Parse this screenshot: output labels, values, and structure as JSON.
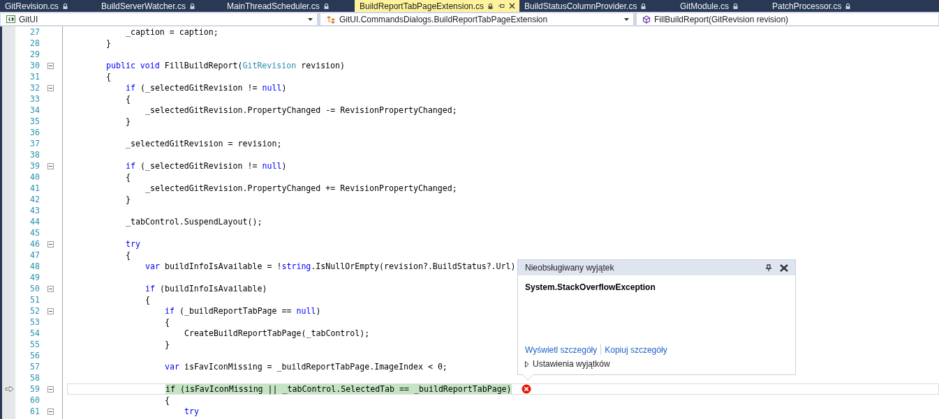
{
  "tabs": [
    {
      "label": "GitRevision.cs",
      "selected": false,
      "locked": true
    },
    {
      "label": "BuildServerWatcher.cs",
      "selected": false,
      "locked": true
    },
    {
      "label": "MainThreadScheduler.cs",
      "selected": false,
      "locked": true
    },
    {
      "label": "BuildReportTabPageExtension.cs",
      "selected": true,
      "locked": true
    },
    {
      "label": "BuildStatusColumnProvider.cs",
      "selected": false,
      "locked": true
    },
    {
      "label": "GitModule.cs",
      "selected": false,
      "locked": true
    },
    {
      "label": "PatchProcessor.cs",
      "selected": false,
      "locked": true
    }
  ],
  "navigation": {
    "project": "GitUI",
    "type": "GitUI.CommandsDialogs.BuildReportTabPageExtension",
    "member": "FillBuildReport(GitRevision revision)"
  },
  "code_lines": [
    {
      "number": "27",
      "collapsible": false,
      "current": false,
      "error": false,
      "segments": [
        {
          "kind": "plain",
          "text": "            _caption = caption;"
        }
      ]
    },
    {
      "number": "28",
      "collapsible": false,
      "current": false,
      "error": false,
      "segments": [
        {
          "kind": "plain",
          "text": "        }"
        }
      ]
    },
    {
      "number": "29",
      "collapsible": false,
      "current": false,
      "error": false
    },
    {
      "number": "30",
      "collapsible": true,
      "current": false,
      "error": false,
      "segments": [
        {
          "kind": "keyword",
          "text": "        public void "
        },
        {
          "kind": "plain",
          "text": "FillBuildReport("
        },
        {
          "kind": "type",
          "text": "GitRevision"
        },
        {
          "kind": "plain",
          "text": " revision)"
        }
      ]
    },
    {
      "number": "31",
      "collapsible": false,
      "current": false,
      "error": false,
      "segments": [
        {
          "kind": "plain",
          "text": "        {"
        }
      ]
    },
    {
      "number": "32",
      "collapsible": true,
      "current": false,
      "error": false,
      "segments": [
        {
          "kind": "keyword",
          "text": "            if"
        },
        {
          "kind": "plain",
          "text": " (_selectedGitRevision != "
        },
        {
          "kind": "keyword",
          "text": "null"
        },
        {
          "kind": "plain",
          "text": ")"
        }
      ]
    },
    {
      "number": "33",
      "collapsible": false,
      "current": false,
      "error": false,
      "segments": [
        {
          "kind": "plain",
          "text": "            {"
        }
      ]
    },
    {
      "number": "34",
      "collapsible": false,
      "current": false,
      "error": false,
      "segments": [
        {
          "kind": "plain",
          "text": "                _selectedGitRevision.PropertyChanged -= RevisionPropertyChanged;"
        }
      ]
    },
    {
      "number": "35",
      "collapsible": false,
      "current": false,
      "error": false,
      "segments": [
        {
          "kind": "plain",
          "text": "            }"
        }
      ]
    },
    {
      "number": "36",
      "collapsible": false,
      "current": false,
      "error": false
    },
    {
      "number": "37",
      "collapsible": false,
      "current": false,
      "error": false,
      "segments": [
        {
          "kind": "plain",
          "text": "            _selectedGitRevision = revision;"
        }
      ]
    },
    {
      "number": "38",
      "collapsible": false,
      "current": false,
      "error": false
    },
    {
      "number": "39",
      "collapsible": true,
      "current": false,
      "error": false,
      "segments": [
        {
          "kind": "keyword",
          "text": "            if"
        },
        {
          "kind": "plain",
          "text": " (_selectedGitRevision != "
        },
        {
          "kind": "keyword",
          "text": "null"
        },
        {
          "kind": "plain",
          "text": ")"
        }
      ]
    },
    {
      "number": "40",
      "collapsible": false,
      "current": false,
      "error": false,
      "segments": [
        {
          "kind": "plain",
          "text": "            {"
        }
      ]
    },
    {
      "number": "41",
      "collapsible": false,
      "current": false,
      "error": false,
      "segments": [
        {
          "kind": "plain",
          "text": "                _selectedGitRevision.PropertyChanged += RevisionPropertyChanged;"
        }
      ]
    },
    {
      "number": "42",
      "collapsible": false,
      "current": false,
      "error": false,
      "segments": [
        {
          "kind": "plain",
          "text": "            }"
        }
      ]
    },
    {
      "number": "43",
      "collapsible": false,
      "current": false,
      "error": false
    },
    {
      "number": "44",
      "collapsible": false,
      "current": false,
      "error": false,
      "segments": [
        {
          "kind": "plain",
          "text": "            _tabControl.SuspendLayout();"
        }
      ]
    },
    {
      "number": "45",
      "collapsible": false,
      "current": false,
      "error": false
    },
    {
      "number": "46",
      "collapsible": true,
      "current": false,
      "error": false,
      "segments": [
        {
          "kind": "keyword",
          "text": "            try"
        }
      ]
    },
    {
      "number": "47",
      "collapsible": false,
      "current": false,
      "error": false,
      "segments": [
        {
          "kind": "plain",
          "text": "            {"
        }
      ]
    },
    {
      "number": "48",
      "collapsible": false,
      "current": false,
      "error": false,
      "segments": [
        {
          "kind": "keyword",
          "text": "                var"
        },
        {
          "kind": "plain",
          "text": " buildInfoIsAvailable = !"
        },
        {
          "kind": "keyword",
          "text": "string"
        },
        {
          "kind": "plain",
          "text": ".IsNullOrEmpty(revision?.BuildStatus?.Url)"
        }
      ]
    },
    {
      "number": "49",
      "collapsible": false,
      "current": false,
      "error": false
    },
    {
      "number": "50",
      "collapsible": true,
      "current": false,
      "error": false,
      "segments": [
        {
          "kind": "keyword",
          "text": "                if"
        },
        {
          "kind": "plain",
          "text": " (buildInfoIsAvailable)"
        }
      ]
    },
    {
      "number": "51",
      "collapsible": false,
      "current": false,
      "error": false,
      "segments": [
        {
          "kind": "plain",
          "text": "                {"
        }
      ]
    },
    {
      "number": "52",
      "collapsible": true,
      "current": false,
      "error": false,
      "segments": [
        {
          "kind": "keyword",
          "text": "                    if"
        },
        {
          "kind": "plain",
          "text": " (_buildReportTabPage == "
        },
        {
          "kind": "keyword",
          "text": "null"
        },
        {
          "kind": "plain",
          "text": ")"
        }
      ]
    },
    {
      "number": "53",
      "collapsible": false,
      "current": false,
      "error": false,
      "segments": [
        {
          "kind": "plain",
          "text": "                    {"
        }
      ]
    },
    {
      "number": "54",
      "collapsible": false,
      "current": false,
      "error": false,
      "segments": [
        {
          "kind": "plain",
          "text": "                        CreateBuildReportTabPage(_tabControl);"
        }
      ]
    },
    {
      "number": "55",
      "collapsible": false,
      "current": false,
      "error": false,
      "segments": [
        {
          "kind": "plain",
          "text": "                    }"
        }
      ]
    },
    {
      "number": "56",
      "collapsible": false,
      "current": false,
      "error": false
    },
    {
      "number": "57",
      "collapsible": false,
      "current": false,
      "error": false,
      "segments": [
        {
          "kind": "keyword",
          "text": "                    var"
        },
        {
          "kind": "plain",
          "text": " isFavIconMissing = _buildReportTabPage.ImageIndex < 0;"
        }
      ]
    },
    {
      "number": "58",
      "collapsible": false,
      "current": false,
      "error": false
    },
    {
      "number": "59",
      "collapsible": true,
      "current": true,
      "error": true,
      "segments": [
        {
          "kind": "plain",
          "text": "                    if (isFavIconMissing || _tabControl.SelectedTab == _buildReportTabPage)"
        }
      ]
    },
    {
      "number": "60",
      "collapsible": false,
      "current": false,
      "error": false,
      "segments": [
        {
          "kind": "plain",
          "text": "                    {"
        }
      ]
    },
    {
      "number": "61",
      "collapsible": true,
      "current": false,
      "error": false,
      "segments": [
        {
          "kind": "keyword",
          "text": "                        try"
        }
      ]
    }
  ],
  "exception_popup": {
    "title": "Nieobsługiwany wyjątek",
    "exception": "System.StackOverflowException",
    "links": [
      "Wyświetl szczegóły",
      "Kopiuj szczegóły"
    ],
    "settings": {
      "label": "Ustawienia wyjątków",
      "expanded": false
    }
  }
}
